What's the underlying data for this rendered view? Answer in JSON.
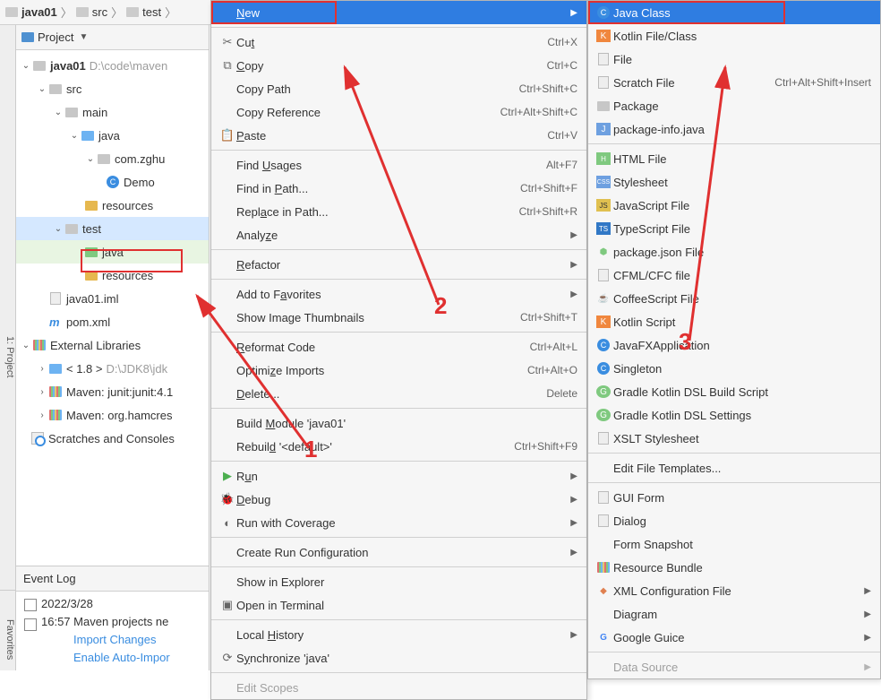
{
  "breadcrumb": {
    "root": "java01",
    "p1": "src",
    "p2": "test"
  },
  "project": {
    "label": "Project",
    "root": {
      "name": "java01",
      "path": "D:\\code\\maven"
    },
    "src": {
      "name": "src",
      "main": "main",
      "java": "java",
      "pkg": "com.zghu",
      "cls": "Demo",
      "res": "resources",
      "test": "test",
      "test_java": "java",
      "test_res": "resources"
    },
    "iml": "java01.iml",
    "pom": "pom.xml",
    "ext": {
      "label": "External Libraries",
      "jdk": "< 1.8 >",
      "jdk_path": "D:\\JDK8\\jdk",
      "junit": "Maven: junit:junit:4.1",
      "hamcrest": "Maven: org.hamcres"
    },
    "scratch": "Scratches and Consoles"
  },
  "eventlog": {
    "title": "Event Log",
    "date": "2022/3/28",
    "time": "16:57",
    "msg": "Maven projects ne",
    "link1": "Import Changes",
    "link2": "Enable Auto-Impor"
  },
  "menu": {
    "new": "New",
    "cut": "Cut",
    "cut_s": "Ctrl+X",
    "copy": "Copy",
    "copy_s": "Ctrl+C",
    "copypath": "Copy Path",
    "copypath_s": "Ctrl+Shift+C",
    "copyref": "Copy Reference",
    "copyref_s": "Ctrl+Alt+Shift+C",
    "paste": "Paste",
    "paste_s": "Ctrl+V",
    "findusages": "Find Usages",
    "findusages_s": "Alt+F7",
    "findinpath": "Find in Path...",
    "findinpath_s": "Ctrl+Shift+F",
    "replaceinpath": "Replace in Path...",
    "replaceinpath_s": "Ctrl+Shift+R",
    "analyze": "Analyze",
    "refactor": "Refactor",
    "addfav": "Add to Favorites",
    "thumbs": "Show Image Thumbnails",
    "thumbs_s": "Ctrl+Shift+T",
    "reformat": "Reformat Code",
    "reformat_s": "Ctrl+Alt+L",
    "optim": "Optimize Imports",
    "optim_s": "Ctrl+Alt+O",
    "delete": "Delete...",
    "delete_s": "Delete",
    "buildmod": "Build Module 'java01'",
    "rebuild": "Rebuild '<default>'",
    "rebuild_s": "Ctrl+Shift+F9",
    "run": "Run",
    "debug": "Debug",
    "coverage": "Run with Coverage",
    "createrun": "Create Run Configuration",
    "explorer": "Show in Explorer",
    "terminal": "Open in Terminal",
    "localhist": "Local History",
    "sync": "Synchronize 'java'",
    "editscopes": "Edit Scopes"
  },
  "submenu": {
    "javaclass": "Java Class",
    "kotlin": "Kotlin File/Class",
    "file": "File",
    "scratch": "Scratch File",
    "scratch_s": "Ctrl+Alt+Shift+Insert",
    "package": "Package",
    "pkginfo": "package-info.java",
    "html": "HTML File",
    "css": "Stylesheet",
    "js": "JavaScript File",
    "ts": "TypeScript File",
    "pjson": "package.json File",
    "cfml": "CFML/CFC file",
    "coffee": "CoffeeScript File",
    "kts": "Kotlin Script",
    "jfx": "JavaFXApplication",
    "singleton": "Singleton",
    "grbuild": "Gradle Kotlin DSL Build Script",
    "grset": "Gradle Kotlin DSL Settings",
    "xslt": "XSLT Stylesheet",
    "edittmpl": "Edit File Templates...",
    "guiform": "GUI Form",
    "dialog": "Dialog",
    "formsnap": "Form Snapshot",
    "resbundle": "Resource Bundle",
    "xmlconf": "XML Configuration File",
    "diagram": "Diagram",
    "guice": "Google Guice",
    "datasource": "Data Source"
  },
  "sidebar": {
    "project": "1: Project",
    "fav": "Favorites"
  },
  "anno": {
    "n1": "1",
    "n2": "2",
    "n3": "3"
  }
}
